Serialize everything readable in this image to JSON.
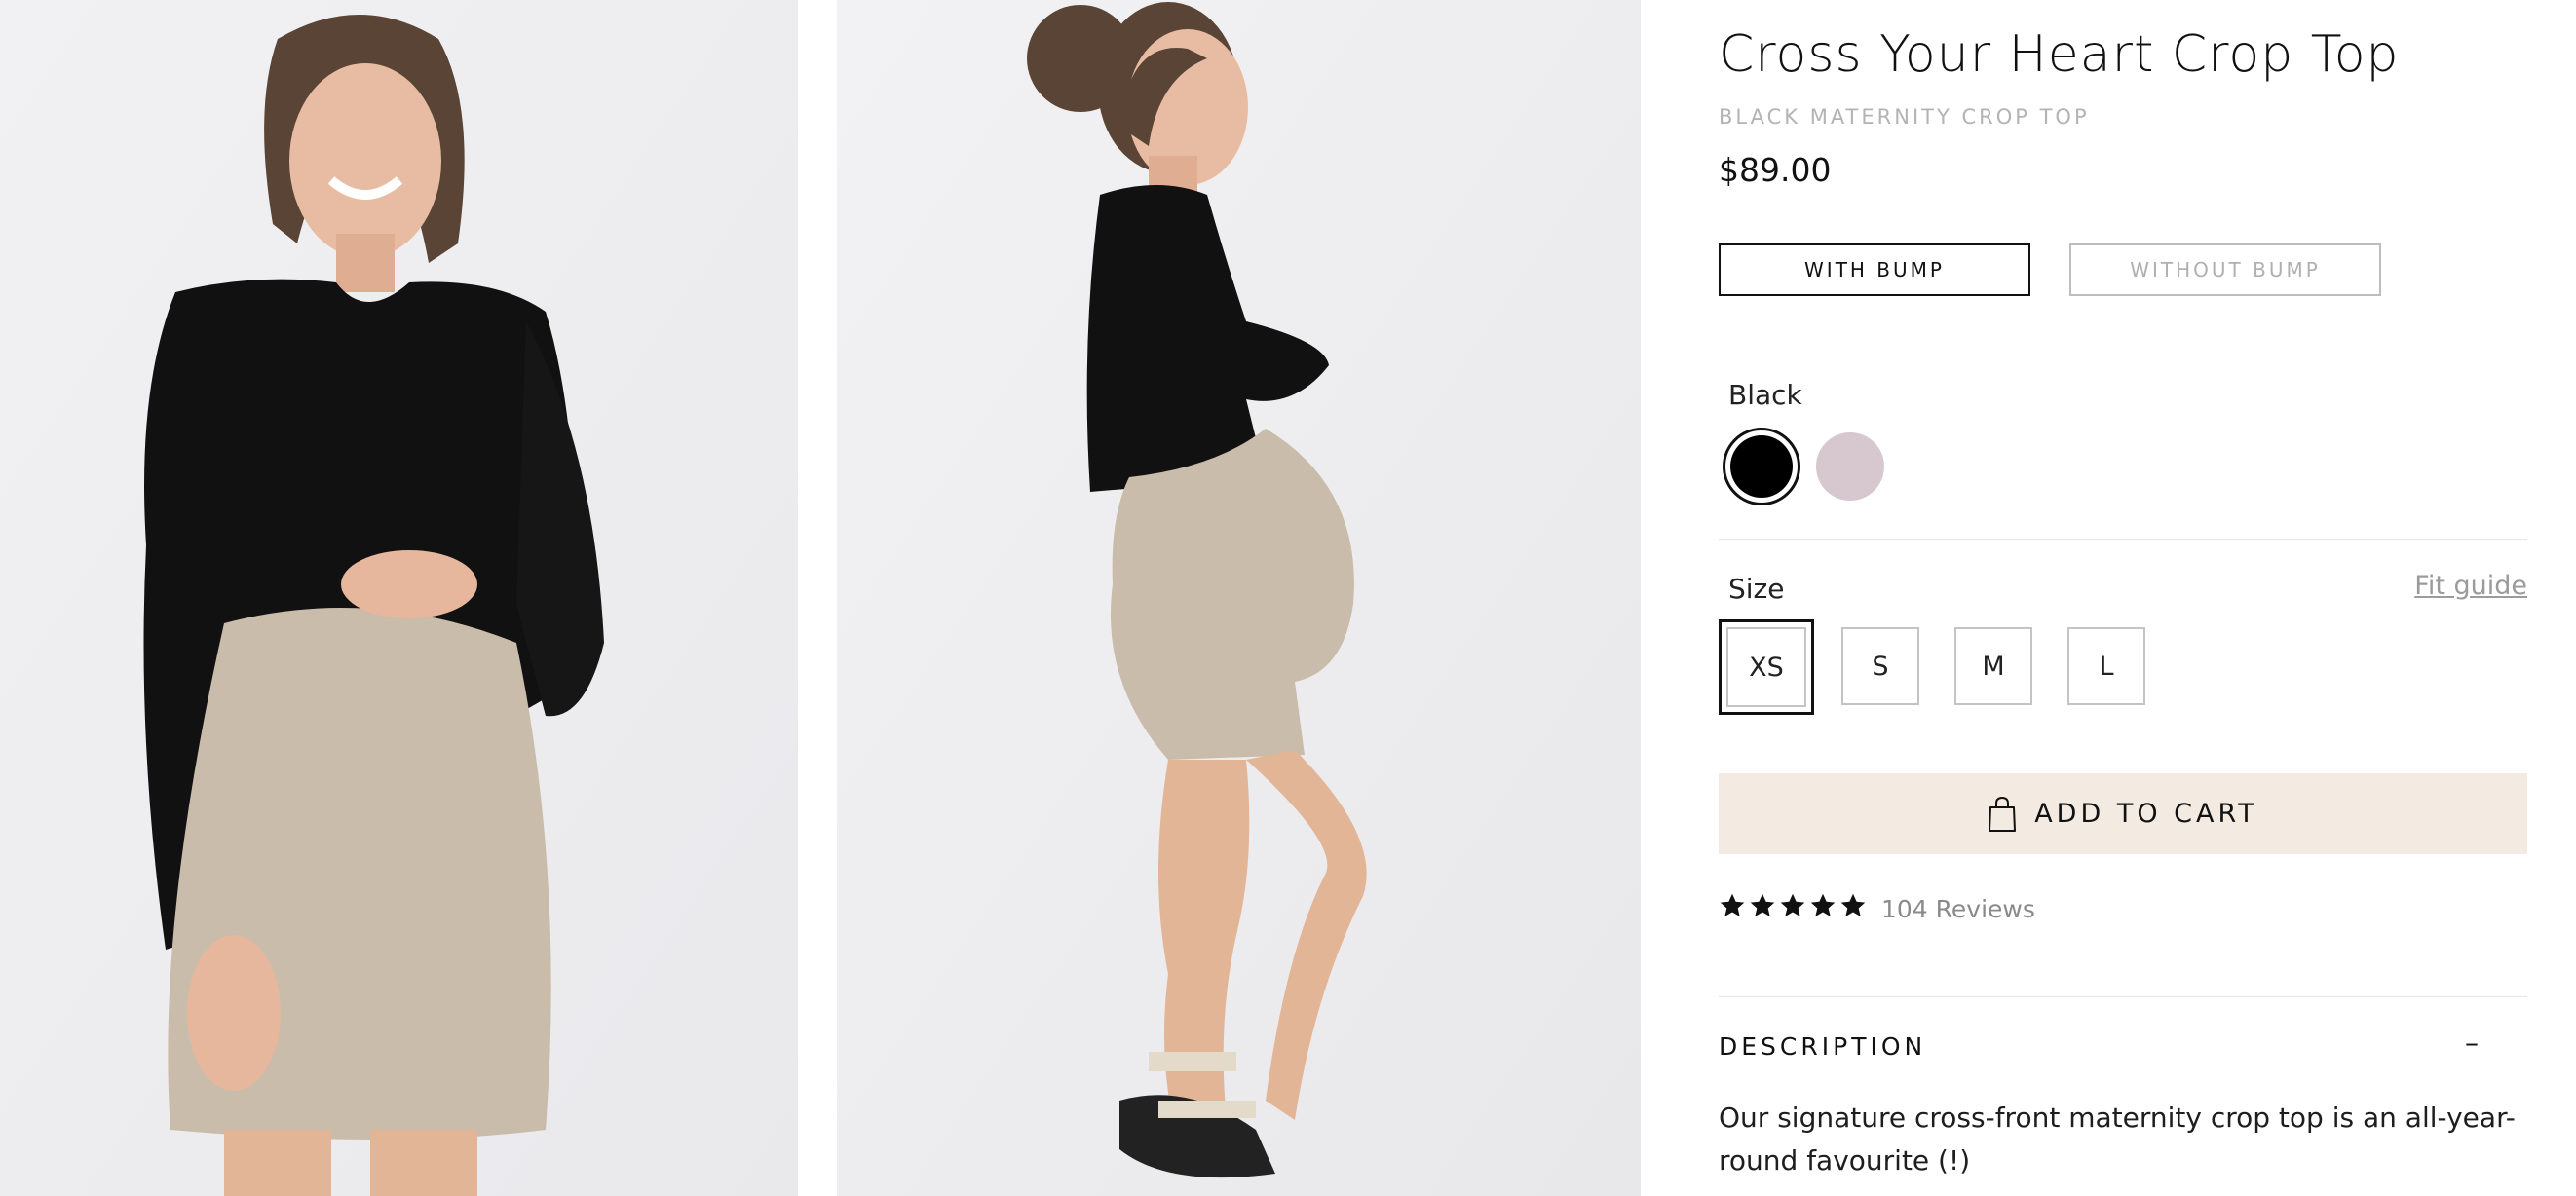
{
  "product": {
    "title": "Cross Your Heart Crop Top",
    "subtitle": "BLACK MATERNITY CROP TOP",
    "price": "$89.00"
  },
  "view_toggle": {
    "with_bump": "WITH BUMP",
    "without_bump": "WITHOUT BUMP",
    "selected": "WITH BUMP"
  },
  "color": {
    "label": "Black",
    "swatches": [
      {
        "name": "black",
        "hex": "#000000",
        "selected": true
      },
      {
        "name": "blush",
        "hex": "#d6c8ce",
        "selected": false
      }
    ]
  },
  "size": {
    "label": "Size",
    "fit_guide": "Fit guide",
    "options": [
      "XS",
      "S",
      "M",
      "L"
    ],
    "selected": "XS"
  },
  "cart": {
    "label": "ADD TO CART",
    "icon": "shopping-bag-icon"
  },
  "rating": {
    "stars": 5,
    "reviews_label": "104 Reviews"
  },
  "description": {
    "heading": "DESCRIPTION",
    "toggle": "–",
    "text": "Our signature cross-front maternity crop top is an all-year-round favourite (!)"
  }
}
